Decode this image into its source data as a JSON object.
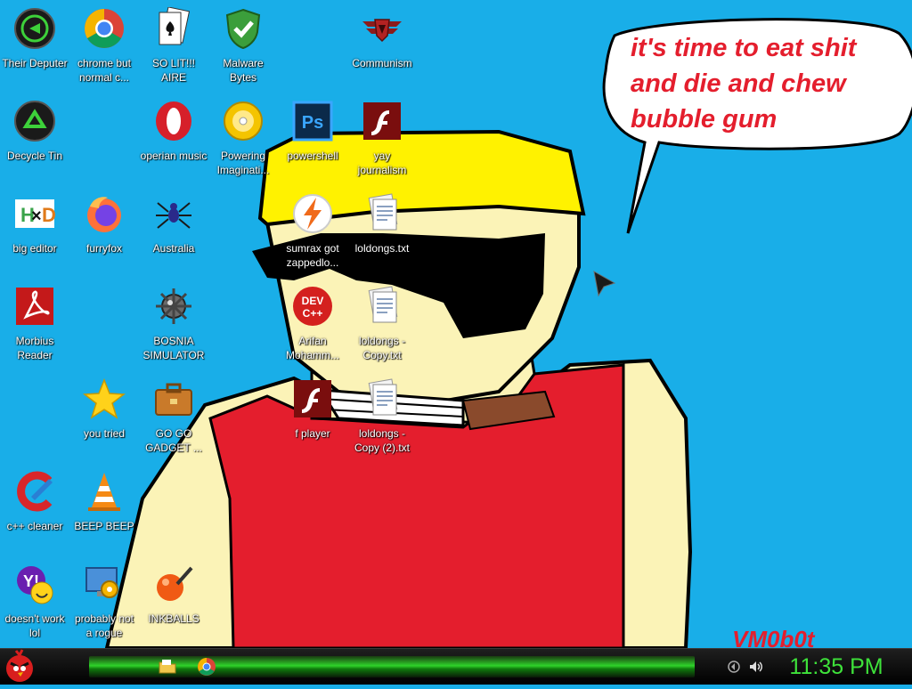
{
  "desktop": {
    "icons": [
      {
        "label": "Their Deputer",
        "icon": "razer-icon"
      },
      {
        "label": "chrome but normal c...",
        "icon": "chrome-icon"
      },
      {
        "label": "SO LIT!!! AIRE",
        "icon": "playing-card-icon"
      },
      {
        "label": "Malware Bytes",
        "icon": "shield-check-icon"
      },
      {
        "label": "Communism",
        "icon": "emblem-icon"
      },
      {
        "label": "Decycle Tin",
        "icon": "recycle-bin-icon"
      },
      {
        "label": "operian music",
        "icon": "opera-icon"
      },
      {
        "label": "Powering Imaginati...",
        "icon": "disc-icon"
      },
      {
        "label": "powershell",
        "icon": "photoshop-icon"
      },
      {
        "label": "yay journalism",
        "icon": "flash-icon"
      },
      {
        "label": "big editor",
        "icon": "hxd-icon"
      },
      {
        "label": "furryfox",
        "icon": "firefox-icon"
      },
      {
        "label": "Australia",
        "icon": "spider-icon"
      },
      {
        "label": "sumrax got zappedlo...",
        "icon": "lightning-icon"
      },
      {
        "label": "loldongs.txt",
        "icon": "text-file-icon"
      },
      {
        "label": "Morbius Reader",
        "icon": "pdf-reader-icon"
      },
      {
        "label": "BOSNIA SIMULATOR",
        "icon": "mine-icon"
      },
      {
        "label": "Arifan Mohamm...",
        "icon": "dev-cpp-icon"
      },
      {
        "label": "loldongs - Copy.txt",
        "icon": "text-file-icon"
      },
      {
        "label": "you tried",
        "icon": "star-icon"
      },
      {
        "label": "GO GO GADGET ...",
        "icon": "briefcase-icon"
      },
      {
        "label": "f player",
        "icon": "flash-icon"
      },
      {
        "label": "loldongs - Copy (2).txt",
        "icon": "text-file-icon"
      },
      {
        "label": "c++ cleaner",
        "icon": "ccleaner-icon"
      },
      {
        "label": "BEEP BEEP",
        "icon": "traffic-cone-icon"
      },
      {
        "label": "doesn't work lol",
        "icon": "yahoo-messenger-icon"
      },
      {
        "label": "probably not a rogue",
        "icon": "gears-monitor-icon"
      },
      {
        "label": "INKBALLS",
        "icon": "ink-ball-icon"
      }
    ]
  },
  "wallpaper": {
    "speech_bubble": "it's time to eat shit and die and chew bubble gum",
    "signature": "VM0b0t"
  },
  "taskbar": {
    "start_icon": "angry-bird-icon",
    "pinned": [
      {
        "name": "file-explorer-icon"
      },
      {
        "name": "chrome-icon"
      }
    ],
    "tray": [
      "network-icon",
      "volume-icon"
    ],
    "clock": "11:35 PM"
  },
  "colors": {
    "desktop_bg": "#19aee8",
    "bubble_text": "#e41e2d",
    "clock": "#3ee23a"
  }
}
